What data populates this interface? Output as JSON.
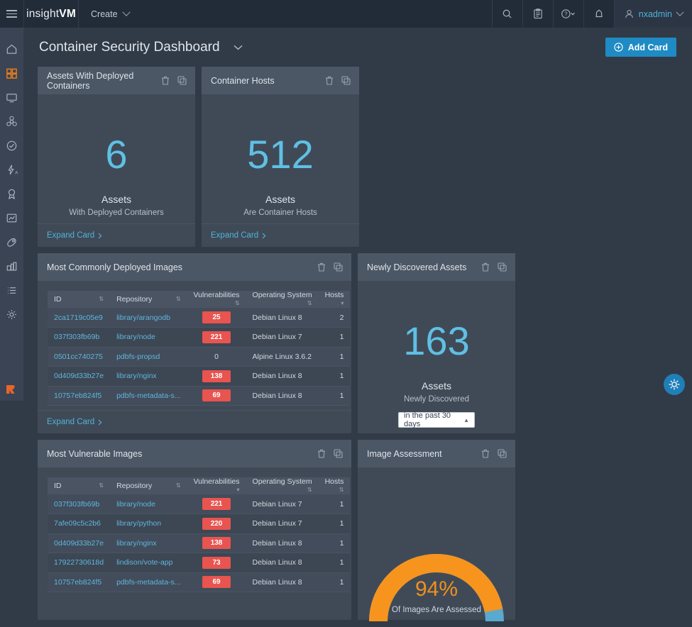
{
  "topbar": {
    "menu_icon": "hamburger-icon",
    "logo_light": "insight",
    "logo_bold": "VM",
    "create_label": "Create",
    "icons": [
      "search-icon",
      "reports-icon",
      "help-icon",
      "bell-icon"
    ],
    "user": "nxadmin"
  },
  "sidebar": {
    "items": [
      {
        "name": "home",
        "active": false
      },
      {
        "name": "dashboard",
        "active": true
      },
      {
        "name": "assets",
        "active": false
      },
      {
        "name": "vulnerabilities",
        "active": false
      },
      {
        "name": "validations",
        "active": false
      },
      {
        "name": "automation",
        "active": false
      },
      {
        "name": "goals-and-slas",
        "active": false
      },
      {
        "name": "reports",
        "active": false
      },
      {
        "name": "tags",
        "active": false
      },
      {
        "name": "containers",
        "active": false
      },
      {
        "name": "policies",
        "active": false
      },
      {
        "name": "administration",
        "active": false
      }
    ],
    "logo": "rapid7-logo"
  },
  "page": {
    "title": "Container Security Dashboard",
    "add_card_label": "Add Card",
    "expand_label": "Expand Card"
  },
  "cards": {
    "assets_with_containers": {
      "title": "Assets With Deployed Containers",
      "value": "6",
      "label": "Assets",
      "sub": "With Deployed Containers"
    },
    "container_hosts": {
      "title": "Container Hosts",
      "value": "512",
      "label": "Assets",
      "sub": "Are Container Hosts"
    },
    "most_commonly_deployed": {
      "title": "Most Commonly Deployed Images",
      "columns": [
        "ID",
        "Repository",
        "Vulnerabilities",
        "Operating System",
        "Hosts"
      ],
      "sort_column": "Hosts",
      "sort_dir": "desc",
      "rows": [
        {
          "id": "2ca1719c05e9",
          "repository": "library/arangodb",
          "vulnerabilities": "25",
          "vuln_badge": true,
          "os": "Debian Linux 8",
          "hosts": "2"
        },
        {
          "id": "037f303fb69b",
          "repository": "library/node",
          "vulnerabilities": "221",
          "vuln_badge": true,
          "os": "Debian Linux 7",
          "hosts": "1"
        },
        {
          "id": "0501cc740275",
          "repository": "pdbfs-propsd",
          "vulnerabilities": "0",
          "vuln_badge": false,
          "os": "Alpine Linux 3.6.2",
          "hosts": "1"
        },
        {
          "id": "0d409d33b27e",
          "repository": "library/nginx",
          "vulnerabilities": "138",
          "vuln_badge": true,
          "os": "Debian Linux 8",
          "hosts": "1"
        },
        {
          "id": "10757eb824f5",
          "repository": "pdbfs-metadata-s...",
          "vulnerabilities": "69",
          "vuln_badge": true,
          "os": "Debian Linux 8",
          "hosts": "1"
        }
      ]
    },
    "newly_discovered": {
      "title": "Newly Discovered Assets",
      "value": "163",
      "label": "Assets",
      "sub": "Newly Discovered",
      "date_range": "in the past 30 days"
    },
    "most_vulnerable": {
      "title": "Most Vulnerable Images",
      "columns": [
        "ID",
        "Repository",
        "Vulnerabilities",
        "Operating System",
        "Hosts"
      ],
      "sort_column": "Vulnerabilities",
      "sort_dir": "desc",
      "rows": [
        {
          "id": "037f303fb69b",
          "repository": "library/node",
          "vulnerabilities": "221",
          "os": "Debian Linux 7",
          "hosts": "1"
        },
        {
          "id": "7afe09c5c2b6",
          "repository": "library/python",
          "vulnerabilities": "220",
          "os": "Debian Linux 7",
          "hosts": "1"
        },
        {
          "id": "0d409d33b27e",
          "repository": "library/nginx",
          "vulnerabilities": "138",
          "os": "Debian Linux 8",
          "hosts": "1"
        },
        {
          "id": "17922730618d",
          "repository": "lindison/vote-app",
          "vulnerabilities": "73",
          "os": "Debian Linux 8",
          "hosts": "1"
        },
        {
          "id": "10757eb824f5",
          "repository": "pdbfs-metadata-s...",
          "vulnerabilities": "69",
          "os": "Debian Linux 8",
          "hosts": "1"
        }
      ]
    },
    "image_assessment": {
      "title": "Image Assessment",
      "value": "94%",
      "caption": "Of Images Are Assessed",
      "percent": 94
    }
  },
  "colors": {
    "accent_blue": "#1f8bc4",
    "stat_blue": "#5fc0e4",
    "gauge_orange": "#f0901e",
    "badge_red": "#e8544f",
    "brand_orange": "#f0801a"
  },
  "fab": {
    "icon": "help-sparkle-icon"
  }
}
